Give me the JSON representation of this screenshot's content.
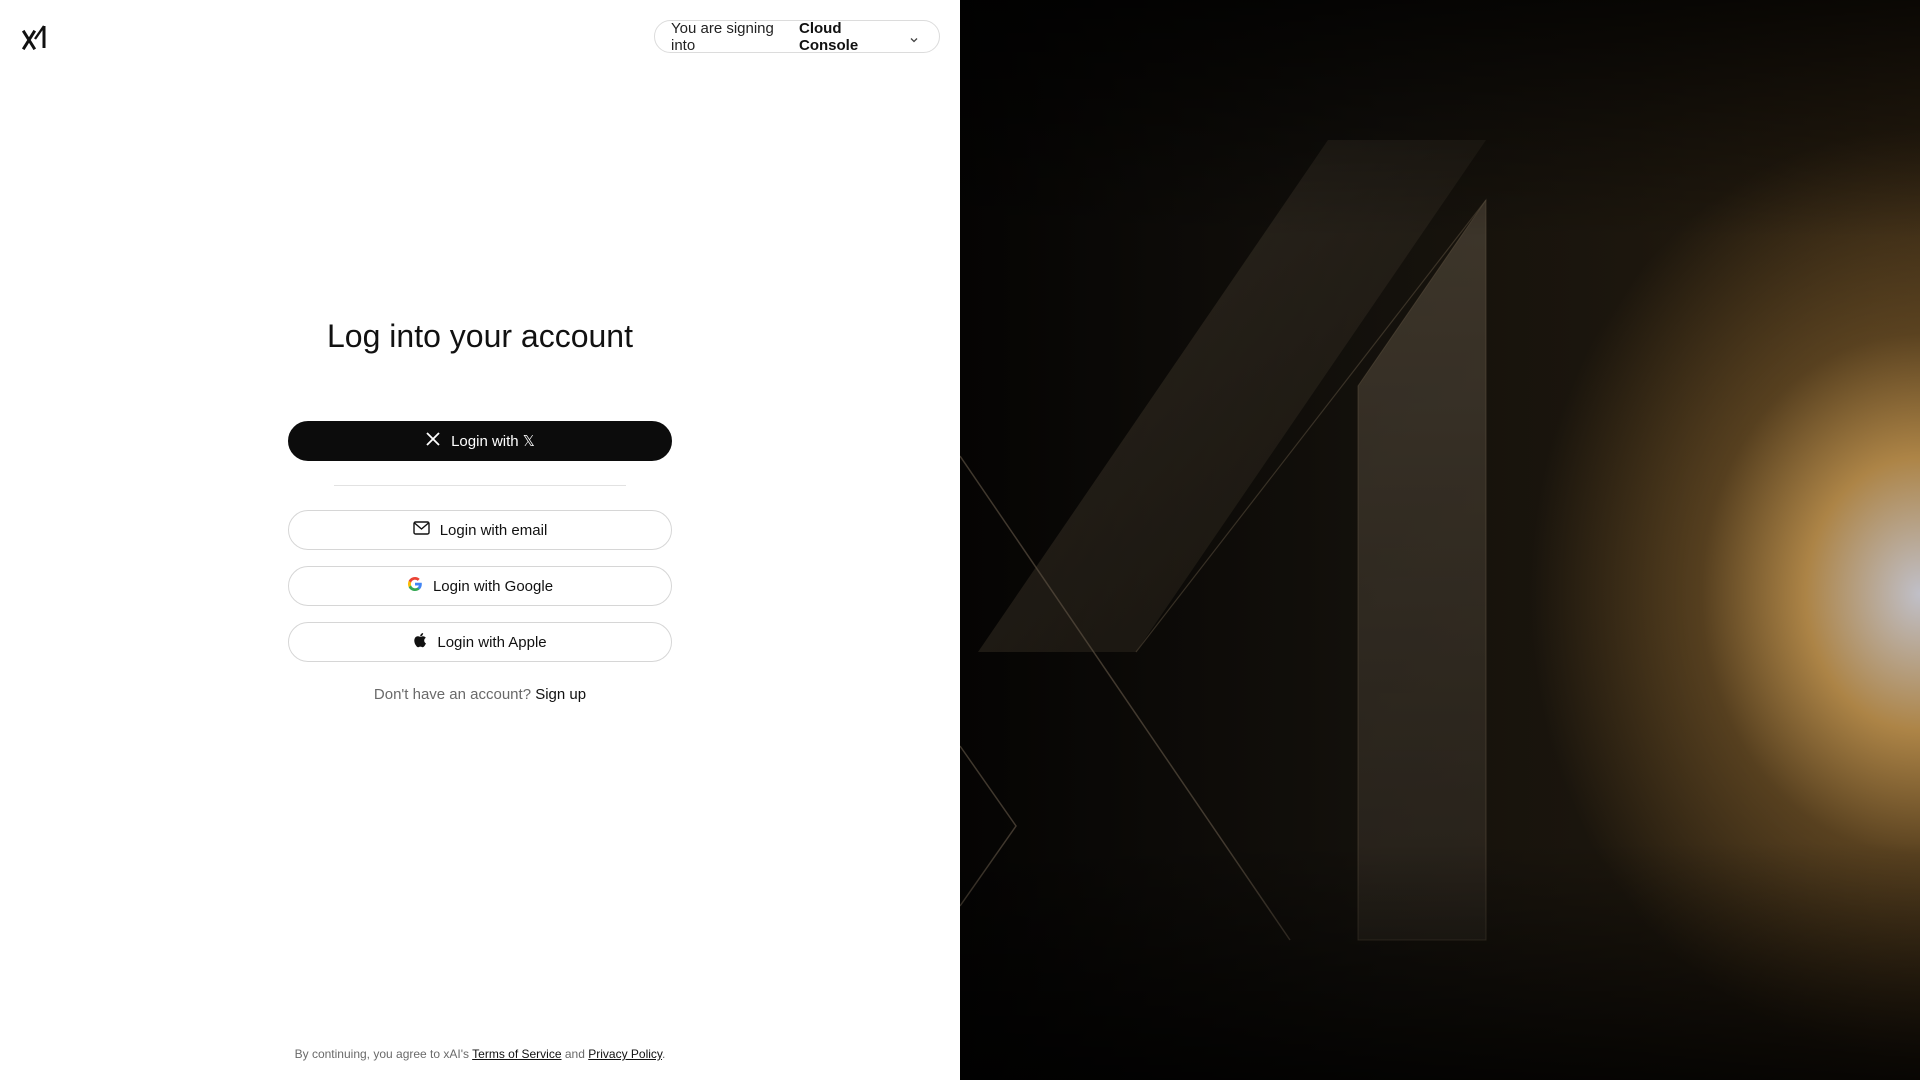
{
  "header": {
    "logo_text": "xAI",
    "signing_prefix": "You are signing into",
    "signing_target": "Cloud Console"
  },
  "main": {
    "title": "Log into your account",
    "buttons": {
      "x": "Login with 𝕏",
      "email": "Login with email",
      "google": "Login with Google",
      "apple": "Login with Apple"
    },
    "signup_prompt": "Don't have an account?",
    "signup_link": "Sign up"
  },
  "footer": {
    "prefix": "By continuing, you agree to xAI's",
    "terms": "Terms of Service",
    "and": "and",
    "privacy": "Privacy Policy",
    "suffix": "."
  },
  "icons": {
    "logo": "xai-logo-icon",
    "chevron": "chevron-down-icon",
    "x": "x-logo-icon",
    "email": "mail-icon",
    "google": "google-icon",
    "apple": "apple-icon"
  },
  "colors": {
    "primary_button": "#0c0c0c",
    "accent_glow": "#c49650"
  }
}
